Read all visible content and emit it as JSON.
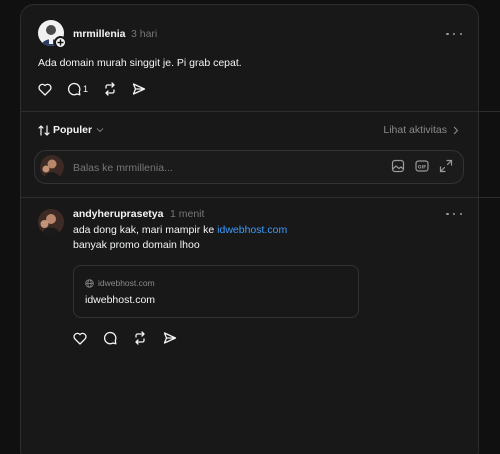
{
  "post": {
    "username": "mrmillenia",
    "time": "3 hari",
    "text": "Ada domain murah singgit je. Pi grab cepat.",
    "reply_count": "1"
  },
  "sort": {
    "label": "Populer"
  },
  "activity": {
    "label": "Lihat aktivitas"
  },
  "reply_input": {
    "placeholder": "Balas ke mrmillenia..."
  },
  "reply": {
    "username": "andyheruprasetya",
    "time": "1 menit",
    "line1_text": "ada dong kak, mari mampir ke ",
    "line1_link": "idwebhost.com",
    "line2": "banyak promo domain lhoo",
    "preview": {
      "domain": "idwebhost.com",
      "title": "idwebhost.com"
    }
  },
  "colors": {
    "background": "#101010",
    "panel": "#181818",
    "border": "#2d2d2d",
    "text_primary": "#f3f5f7",
    "text_secondary": "#777777",
    "link": "#3b9bff"
  }
}
